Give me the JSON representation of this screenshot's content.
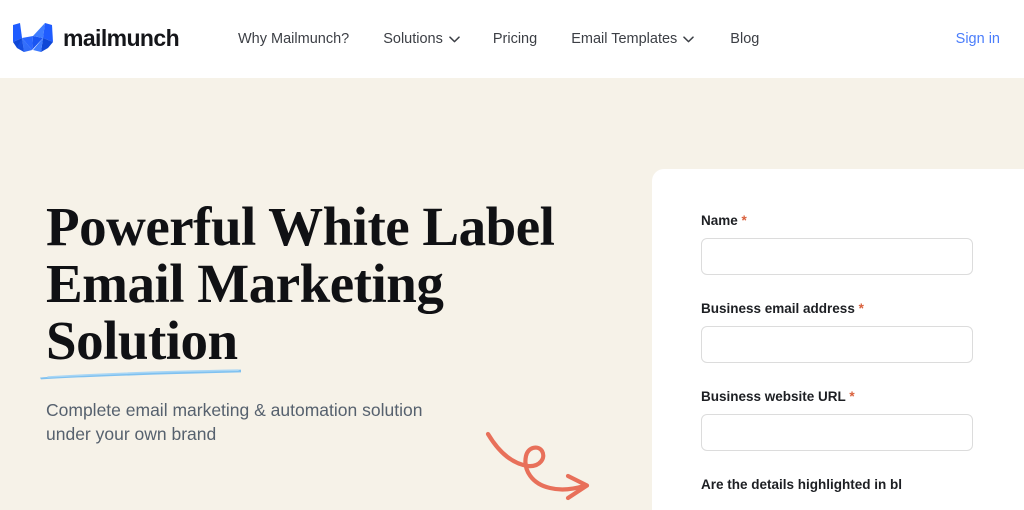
{
  "header": {
    "brand_name": "mailmunch",
    "brand_logo_icon": "mailmunch-m-logo-icon",
    "nav_items": [
      {
        "label": "Why Mailmunch?",
        "has_dropdown": false
      },
      {
        "label": "Solutions",
        "has_dropdown": true
      },
      {
        "label": "Pricing",
        "has_dropdown": false
      },
      {
        "label": "Email Templates",
        "has_dropdown": true
      },
      {
        "label": "Blog",
        "has_dropdown": false
      }
    ],
    "signin_label": "Sign in",
    "signin_color": "#4a7dfb"
  },
  "hero": {
    "headline": "Powerful White Label\nEmail Marketing\nSolution",
    "headline_underline_color": "#7fc1f0",
    "subheadline": "Complete email marketing & automation solution\nunder your own brand",
    "background_color": "#f6f2e8",
    "arrow_decoration_icon": "curly-arrow-icon",
    "arrow_decoration_color": "#e8705a"
  },
  "form": {
    "fields": [
      {
        "label": "Name",
        "required_marker": "*",
        "value": "",
        "placeholder": ""
      },
      {
        "label": "Business email address",
        "required_marker": "*",
        "value": "",
        "placeholder": ""
      },
      {
        "label": "Business website URL",
        "required_marker": "*",
        "value": "",
        "placeholder": ""
      }
    ],
    "clipped_label": "Are the details highlighted in bl",
    "required_marker_color": "#d9603c",
    "input_border_color": "#dcdcdc",
    "panel_background": "#ffffff"
  }
}
